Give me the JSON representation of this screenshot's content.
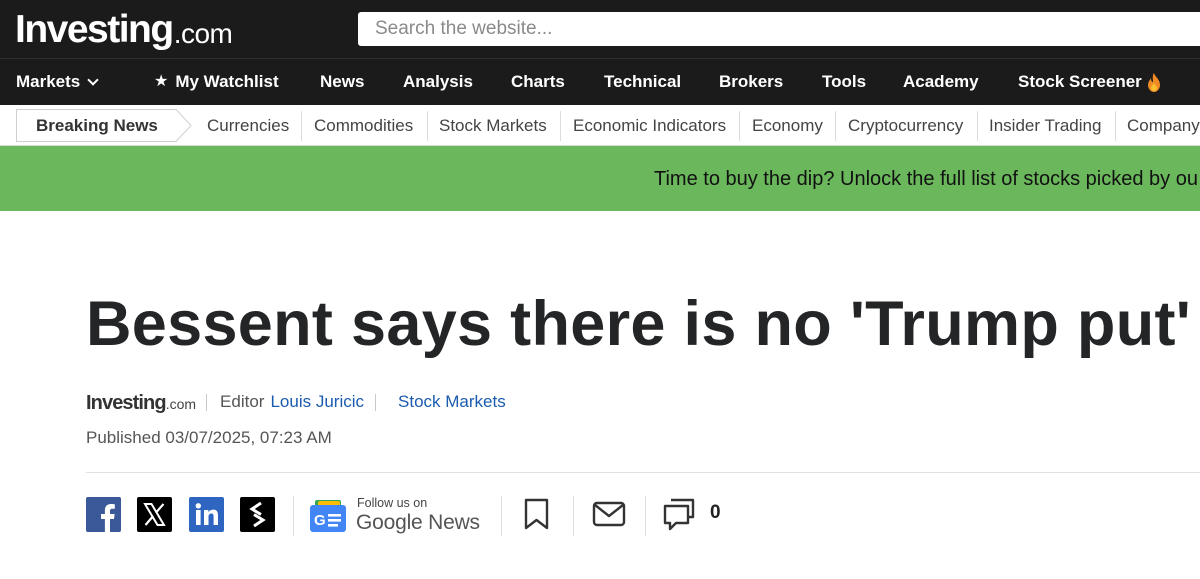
{
  "header": {
    "logo_main": "Investing",
    "logo_suffix": ".com",
    "search_placeholder": "Search the website..."
  },
  "main_nav": {
    "items": [
      {
        "label": "Markets",
        "icon": "chevron-down-icon"
      },
      {
        "label": "My Watchlist",
        "icon": "star-icon"
      },
      {
        "label": "News"
      },
      {
        "label": "Analysis"
      },
      {
        "label": "Charts"
      },
      {
        "label": "Technical"
      },
      {
        "label": "Brokers"
      },
      {
        "label": "Tools"
      },
      {
        "label": "Academy"
      },
      {
        "label": "Stock Screener",
        "icon": "flame-icon"
      }
    ]
  },
  "sub_nav": {
    "active": "Breaking News",
    "items": [
      "Currencies",
      "Commodities",
      "Stock Markets",
      "Economic Indicators",
      "Economy",
      "Cryptocurrency",
      "Insider Trading",
      "Company"
    ]
  },
  "banner": {
    "text": "Time to buy the dip? Unlock the full list of stocks picked by ou",
    "color": "#6ab75c"
  },
  "article": {
    "headline": "Bessent says there is no 'Trump put'",
    "source_logo_main": "Investing",
    "source_logo_suffix": ".com",
    "editor_label": "Editor",
    "author": "Louis Juricic",
    "category": "Stock Markets",
    "published": "Published 03/07/2025, 07:23 AM"
  },
  "share": {
    "icons": [
      "facebook-icon",
      "x-icon",
      "linkedin-icon",
      "stocktwits-icon"
    ],
    "google_news_follow": "Follow us on",
    "google_news_label": "Google News",
    "comment_count": "0"
  },
  "colors": {
    "header_bg": "#1b1b1b",
    "link": "#1b5bb0",
    "facebook": "#3b5998",
    "linkedin": "#2e65c1"
  }
}
